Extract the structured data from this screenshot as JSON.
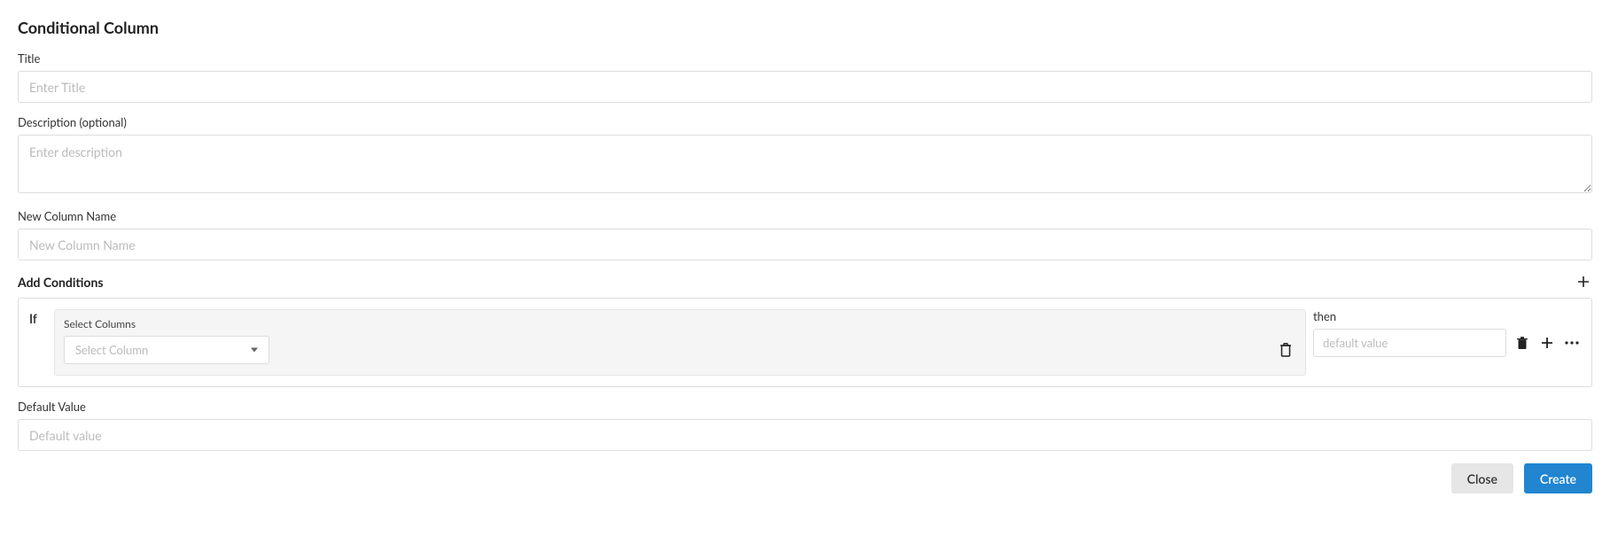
{
  "header": {
    "title": "Conditional Column"
  },
  "fields": {
    "title": {
      "label": "Title",
      "placeholder": "Enter Title",
      "value": ""
    },
    "description": {
      "label": "Description (optional)",
      "placeholder": "Enter description",
      "value": ""
    },
    "newColumnName": {
      "label": "New Column Name",
      "placeholder": "New Column Name",
      "value": ""
    },
    "defaultValue": {
      "label": "Default Value",
      "placeholder": "Default value",
      "value": ""
    }
  },
  "conditions": {
    "title": "Add Conditions",
    "ifLabel": "If",
    "thenLabel": "then",
    "selectColumnsLabel": "Select Columns",
    "selectColumnPlaceholder": "Select Column",
    "thenPlaceholder": "default value"
  },
  "buttons": {
    "close": "Close",
    "create": "Create"
  }
}
